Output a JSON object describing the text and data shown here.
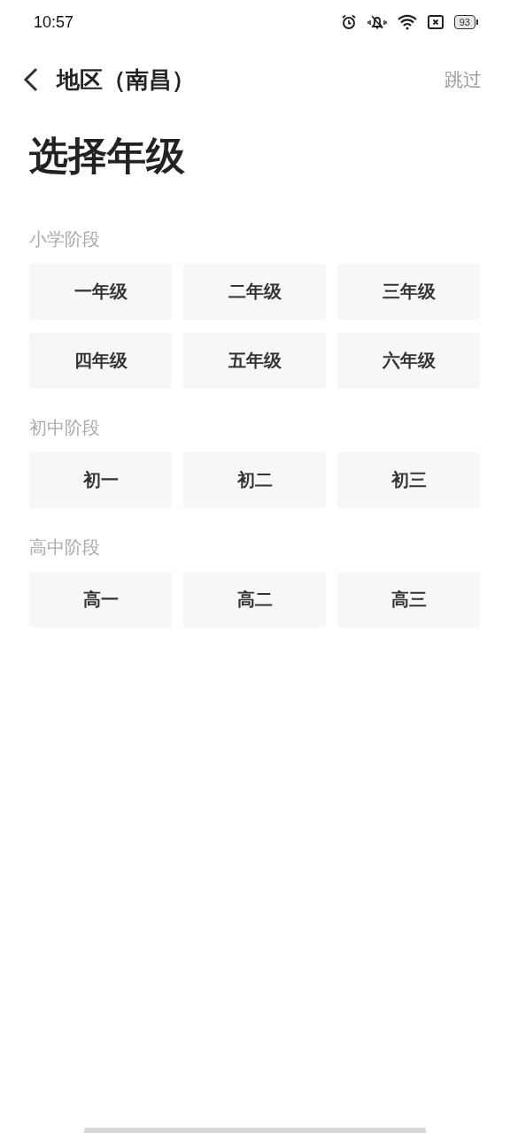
{
  "status_bar": {
    "time": "10:57",
    "battery": "93"
  },
  "header": {
    "title": "地区（南昌）",
    "skip": "跳过"
  },
  "heading": "选择年级",
  "sections": [
    {
      "title": "小学阶段",
      "grades": [
        "一年级",
        "二年级",
        "三年级",
        "四年级",
        "五年级",
        "六年级"
      ]
    },
    {
      "title": "初中阶段",
      "grades": [
        "初一",
        "初二",
        "初三"
      ]
    },
    {
      "title": "高中阶段",
      "grades": [
        "高一",
        "高二",
        "高三"
      ]
    }
  ]
}
